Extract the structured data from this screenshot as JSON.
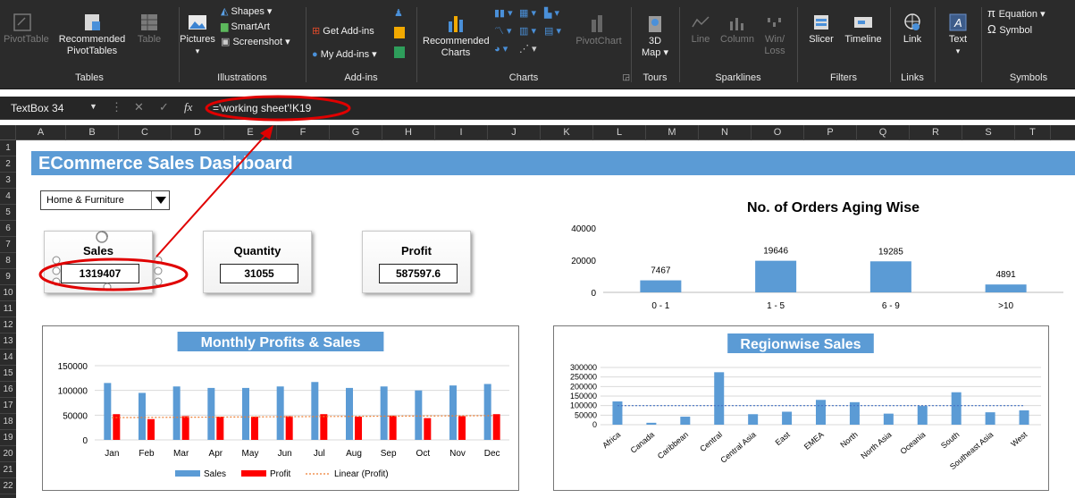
{
  "ribbon": {
    "groups": {
      "tables": "Tables",
      "illustrations": "Illustrations",
      "addins": "Add-ins",
      "charts": "Charts",
      "tours": "Tours",
      "sparklines": "Sparklines",
      "filters": "Filters",
      "links": "Links",
      "symbols": "Symbols"
    },
    "buttons": {
      "pivottable": "PivotTable",
      "recommended_pivot_1": "Recommended",
      "recommended_pivot_2": "PivotTables",
      "table": "Table",
      "pictures": "Pictures",
      "shapes": "Shapes",
      "smartart": "SmartArt",
      "screenshot": "Screenshot",
      "get_addins": "Get Add-ins",
      "my_addins": "My Add-ins",
      "recommended_charts_1": "Recommended",
      "recommended_charts_2": "Charts",
      "pivotchart": "PivotChart",
      "map3d_1": "3D",
      "map3d_2": "Map",
      "line": "Line",
      "column": "Column",
      "winloss_1": "Win/",
      "winloss_2": "Loss",
      "slicer": "Slicer",
      "timeline": "Timeline",
      "link": "Link",
      "text": "Text",
      "equation": "Equation",
      "symbol": "Symbol"
    },
    "colors": {
      "background": "#2b2b2b",
      "text": "#f0f0f0"
    }
  },
  "formula_bar": {
    "name_box": "TextBox 34",
    "fx": "fx",
    "formula": "='working sheet'!K19"
  },
  "columns": [
    "A",
    "B",
    "C",
    "D",
    "E",
    "F",
    "G",
    "H",
    "I",
    "J",
    "K",
    "L",
    "M",
    "N",
    "O",
    "P",
    "Q",
    "R",
    "S",
    "T"
  ],
  "rows": [
    "1",
    "2",
    "3",
    "4",
    "5",
    "6",
    "7",
    "8",
    "9",
    "10",
    "11",
    "12",
    "13",
    "14",
    "15",
    "16",
    "17",
    "18",
    "19",
    "20",
    "21",
    "22"
  ],
  "dashboard": {
    "title": "ECommerce Sales Dashboard",
    "category_select": "Home & Furniture",
    "kpis": {
      "sales_label": "Sales",
      "sales_value": "1319407",
      "quantity_label": "Quantity",
      "quantity_value": "31055",
      "profit_label": "Profit",
      "profit_value": "587597.6"
    },
    "colors": {
      "accent": "#5b9bd5",
      "profit_bar": "#ff0000",
      "trend": "#ed7d31",
      "annotation": "#e00000"
    }
  },
  "chart_data": [
    {
      "type": "bar",
      "title": "No. of Orders Aging Wise",
      "categories": [
        "0 - 1",
        "1 - 5",
        "6 - 9",
        ">10"
      ],
      "values": [
        7467,
        19646,
        19285,
        4891
      ],
      "ylim": [
        0,
        40000
      ],
      "yticks": [
        "0",
        "20000",
        "40000"
      ],
      "grid": false,
      "data_labels": true
    },
    {
      "type": "bar",
      "title": "Monthly Profits & Sales",
      "categories": [
        "Jan",
        "Feb",
        "Mar",
        "Apr",
        "May",
        "Jun",
        "Jul",
        "Aug",
        "Sep",
        "Oct",
        "Nov",
        "Dec"
      ],
      "series": [
        {
          "name": "Sales",
          "values": [
            115000,
            95000,
            108000,
            105000,
            105000,
            108000,
            117000,
            105000,
            108000,
            100000,
            110000,
            113000
          ]
        },
        {
          "name": "Profit",
          "values": [
            52000,
            42000,
            48000,
            47000,
            47000,
            48000,
            52000,
            47000,
            49000,
            44000,
            48000,
            52000
          ]
        }
      ],
      "trendline": {
        "name": "Linear (Profit)",
        "start": 45000,
        "end": 49000
      },
      "ylim": [
        0,
        150000
      ],
      "yticks": [
        "0",
        "50000",
        "100000",
        "150000"
      ],
      "grid": true,
      "legend": "bottom"
    },
    {
      "type": "bar",
      "title": "Regionwise Sales",
      "categories": [
        "Africa",
        "Canada",
        "Caribbean",
        "Central",
        "Central Asia",
        "East",
        "EMEA",
        "North",
        "North Asia",
        "Oceania",
        "South",
        "Southeast Asia",
        "West"
      ],
      "values": [
        122000,
        10000,
        42000,
        275000,
        55000,
        68000,
        130000,
        118000,
        58000,
        98000,
        170000,
        65000,
        75000
      ],
      "average": 100000,
      "ylim": [
        0,
        300000
      ],
      "yticks": [
        "0",
        "50000",
        "100000",
        "150000",
        "200000",
        "250000",
        "300000"
      ],
      "grid": true
    }
  ]
}
